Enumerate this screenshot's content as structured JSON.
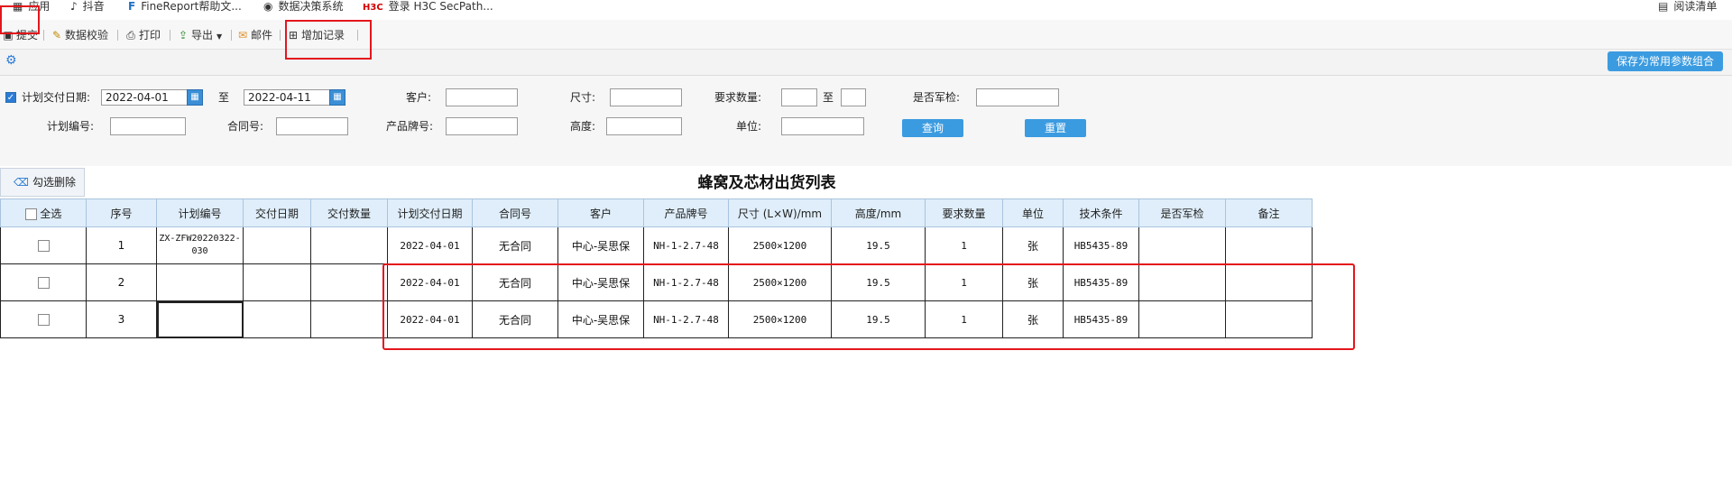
{
  "bookmarks": [
    {
      "icon": "grid-icon",
      "label": "应用"
    },
    {
      "icon": "tiktok-icon",
      "label": "抖音"
    },
    {
      "icon": "finereport-icon",
      "label": "FineReport帮助文..."
    },
    {
      "icon": "globe-icon",
      "label": "数据决策系统"
    },
    {
      "icon": "h3c-icon",
      "label": "登录 H3C SecPath..."
    }
  ],
  "h3c_mark": "H3C",
  "reading_list": "阅读清单",
  "toolbar": {
    "submit": "提交",
    "verify": "数据校验",
    "print": "打印",
    "export": "导出",
    "mail": "邮件",
    "add_record": "增加记录"
  },
  "save_params": "保存为常用参数组合",
  "form": {
    "plan_date_label": "计划交付日期:",
    "date_from": "2022-04-01",
    "to1": "至",
    "date_to": "2022-04-11",
    "customer_label": "客户:",
    "size_label": "尺寸:",
    "qty_label": "要求数量:",
    "to2": "至",
    "military_label": "是否军检:",
    "plan_no_label": "计划编号:",
    "contract_label": "合同号:",
    "brand_label": "产品牌号:",
    "height_label": "高度:",
    "unit_label": "单位:",
    "query_button": "查询",
    "reset_button": "重置"
  },
  "delete_checked": "勾选删除",
  "report_title": "蜂窝及芯材出货列表",
  "table": {
    "headers": [
      "全选",
      "序号",
      "计划编号",
      "交付日期",
      "交付数量",
      "计划交付日期",
      "合同号",
      "客户",
      "产品牌号",
      "尺寸 (L×W)/mm",
      "高度/mm",
      "要求数量",
      "单位",
      "技术条件",
      "是否军检",
      "备注"
    ],
    "rows": [
      {
        "seq": "1",
        "plan_no": "ZX-ZFW20220322-030",
        "delivery_date": "",
        "delivery_qty": "",
        "plan_date": "2022-04-01",
        "contract": "无合同",
        "customer": "中心-吴思保",
        "brand": "NH-1-2.7-48",
        "size": "2500×1200",
        "height": "19.5",
        "req_qty": "1",
        "unit": "张",
        "tech": "HB5435-89",
        "military": "",
        "remark": ""
      },
      {
        "seq": "2",
        "plan_no": "",
        "delivery_date": "",
        "delivery_qty": "",
        "plan_date": "2022-04-01",
        "contract": "无合同",
        "customer": "中心-吴思保",
        "brand": "NH-1-2.7-48",
        "size": "2500×1200",
        "height": "19.5",
        "req_qty": "1",
        "unit": "张",
        "tech": "HB5435-89",
        "military": "",
        "remark": ""
      },
      {
        "seq": "3",
        "plan_no": "",
        "delivery_date": "",
        "delivery_qty": "",
        "plan_date": "2022-04-01",
        "contract": "无合同",
        "customer": "中心-吴思保",
        "brand": "NH-1-2.7-48",
        "size": "2500×1200",
        "height": "19.5",
        "req_qty": "1",
        "unit": "张",
        "tech": "HB5435-89",
        "military": "",
        "remark": ""
      }
    ]
  },
  "colors": {
    "annotation": "#e3161c",
    "button": "#3b9be0",
    "header_bg": "#dfeefa"
  }
}
